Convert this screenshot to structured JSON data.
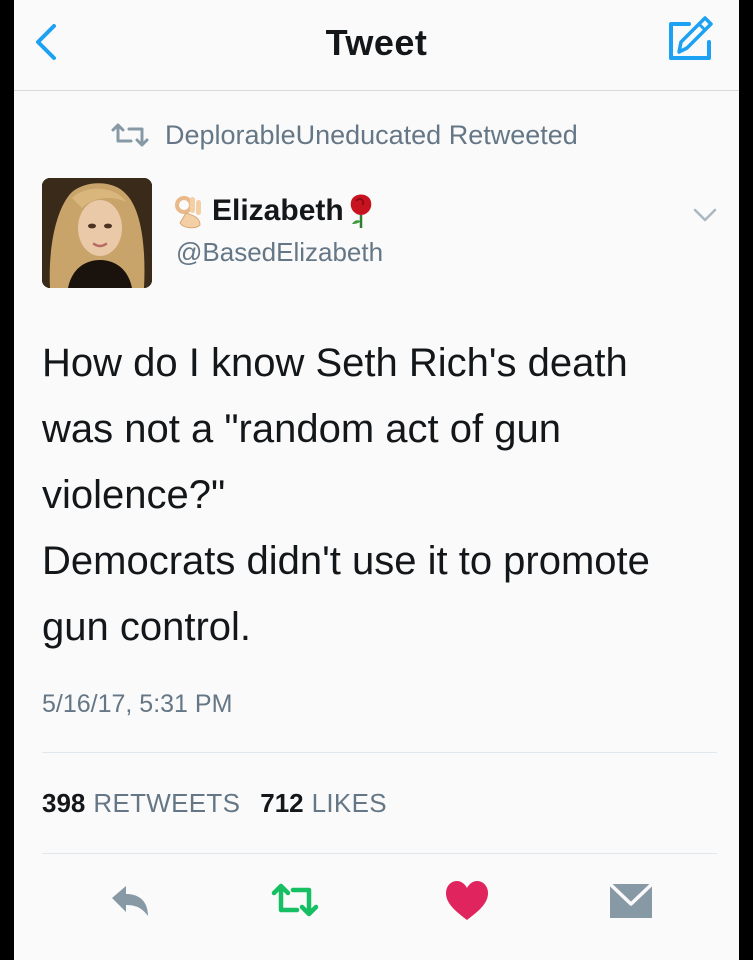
{
  "nav": {
    "title": "Tweet",
    "back_icon": "chevron-left-icon",
    "compose_icon": "compose-icon"
  },
  "retweet_context": {
    "text": "DeplorableUneducated Retweeted",
    "icon": "retweet-icon"
  },
  "author": {
    "display_name": "Elizabeth",
    "handle": "@BasedElizabeth",
    "name_prefix_emoji": "ok-hand-icon",
    "name_suffix_emoji": "rose-icon"
  },
  "tweet": {
    "lines": [
      "How do I know Seth Rich's death",
      "was not a \"random act of gun",
      "violence?\"",
      "Democrats didn't use it to promote",
      "gun control."
    ],
    "timestamp": "5/16/17, 5:31 PM"
  },
  "stats": {
    "retweets_count": "398",
    "retweets_label": "RETWEETS",
    "likes_count": "712",
    "likes_label": "LIKES"
  },
  "actions": [
    "reply-icon",
    "retweet-icon",
    "like-icon",
    "direct-message-icon"
  ],
  "colors": {
    "accent_blue": "#1da1f2",
    "retweet_green": "#17bf63",
    "like_red": "#e0245e",
    "secondary_text": "#657786"
  }
}
